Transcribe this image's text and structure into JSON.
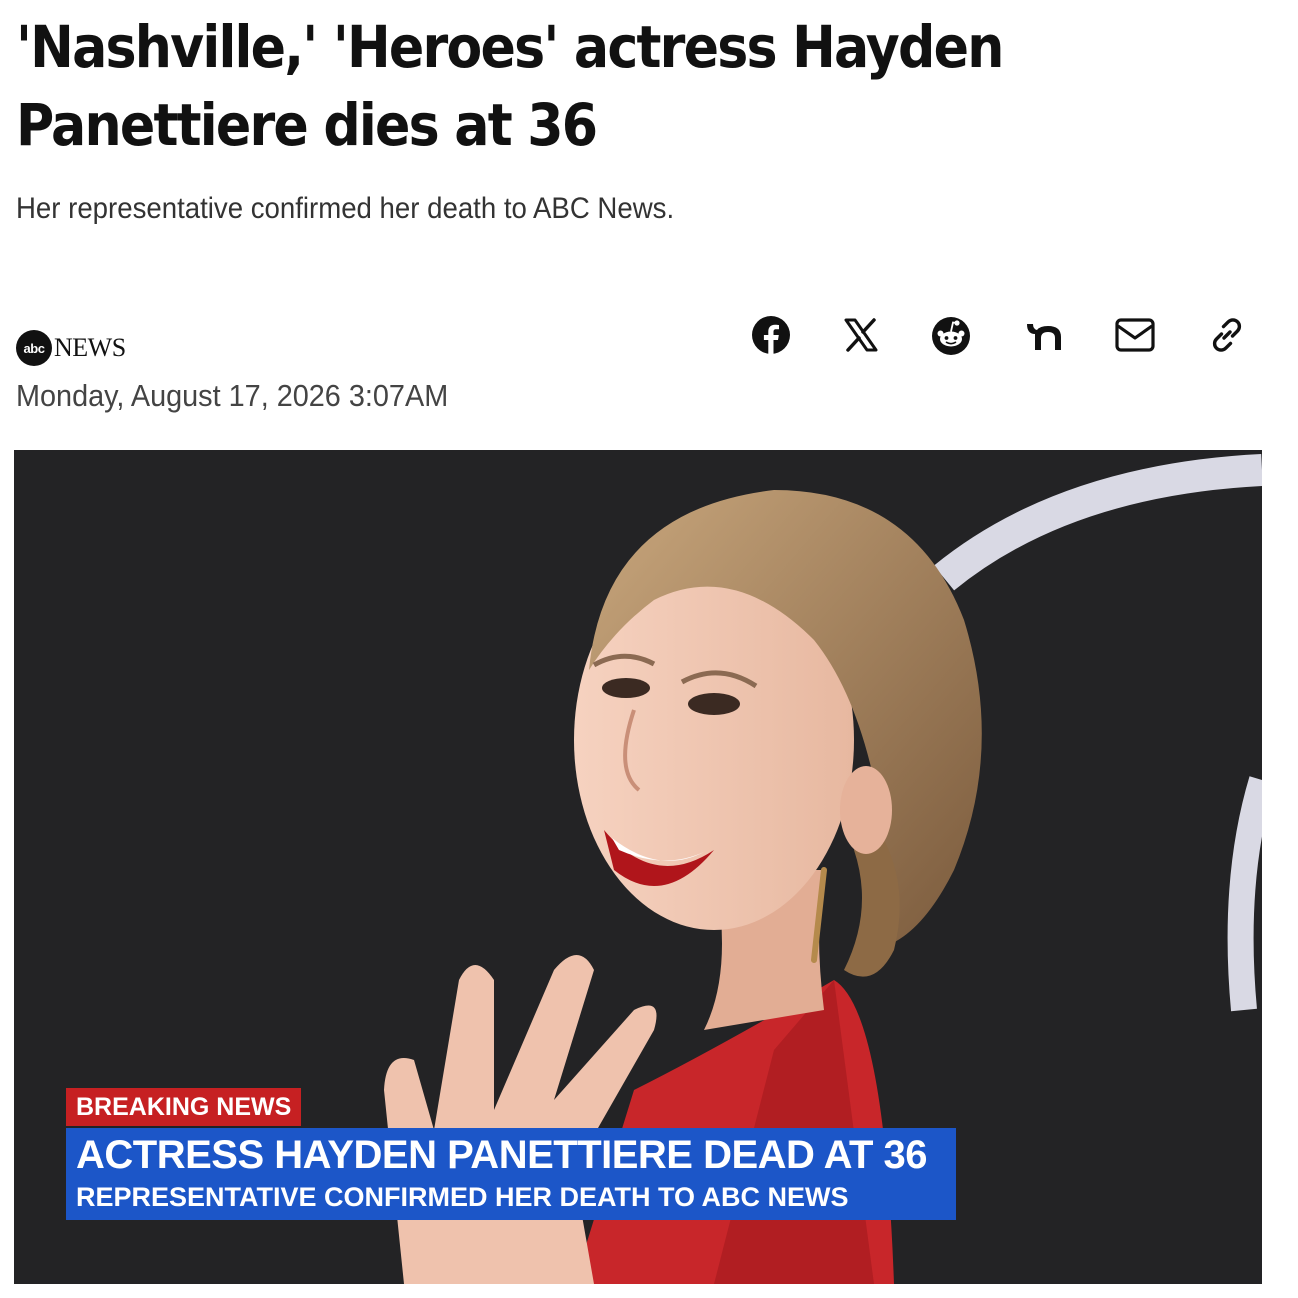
{
  "article": {
    "headline": "'Nashville,' 'Heroes' actress Hayden Panettiere dies at 36",
    "subheadline": "Her representative confirmed her death to ABC News.",
    "source_logo": {
      "mark": "abc",
      "word": "NEWS"
    },
    "dateline": "Monday, August 17, 2026 3:07AM"
  },
  "share": {
    "buttons": [
      {
        "icon": "facebook-icon"
      },
      {
        "icon": "x-icon"
      },
      {
        "icon": "reddit-icon"
      },
      {
        "icon": "nextdoor-icon"
      },
      {
        "icon": "email-icon"
      },
      {
        "icon": "link-icon"
      }
    ]
  },
  "photo": {
    "lower_third": {
      "tag": "BREAKING NEWS",
      "headline": "ACTRESS HAYDEN PANETTIERE DEAD AT 36",
      "subline": "REPRESENTATIVE CONFIRMED HER DEATH TO ABC NEWS"
    }
  },
  "colors": {
    "breaking_red": "#c62022",
    "chyron_blue": "#1c56c8",
    "photo_background": "#232325",
    "dress_red": "#c8262a"
  }
}
